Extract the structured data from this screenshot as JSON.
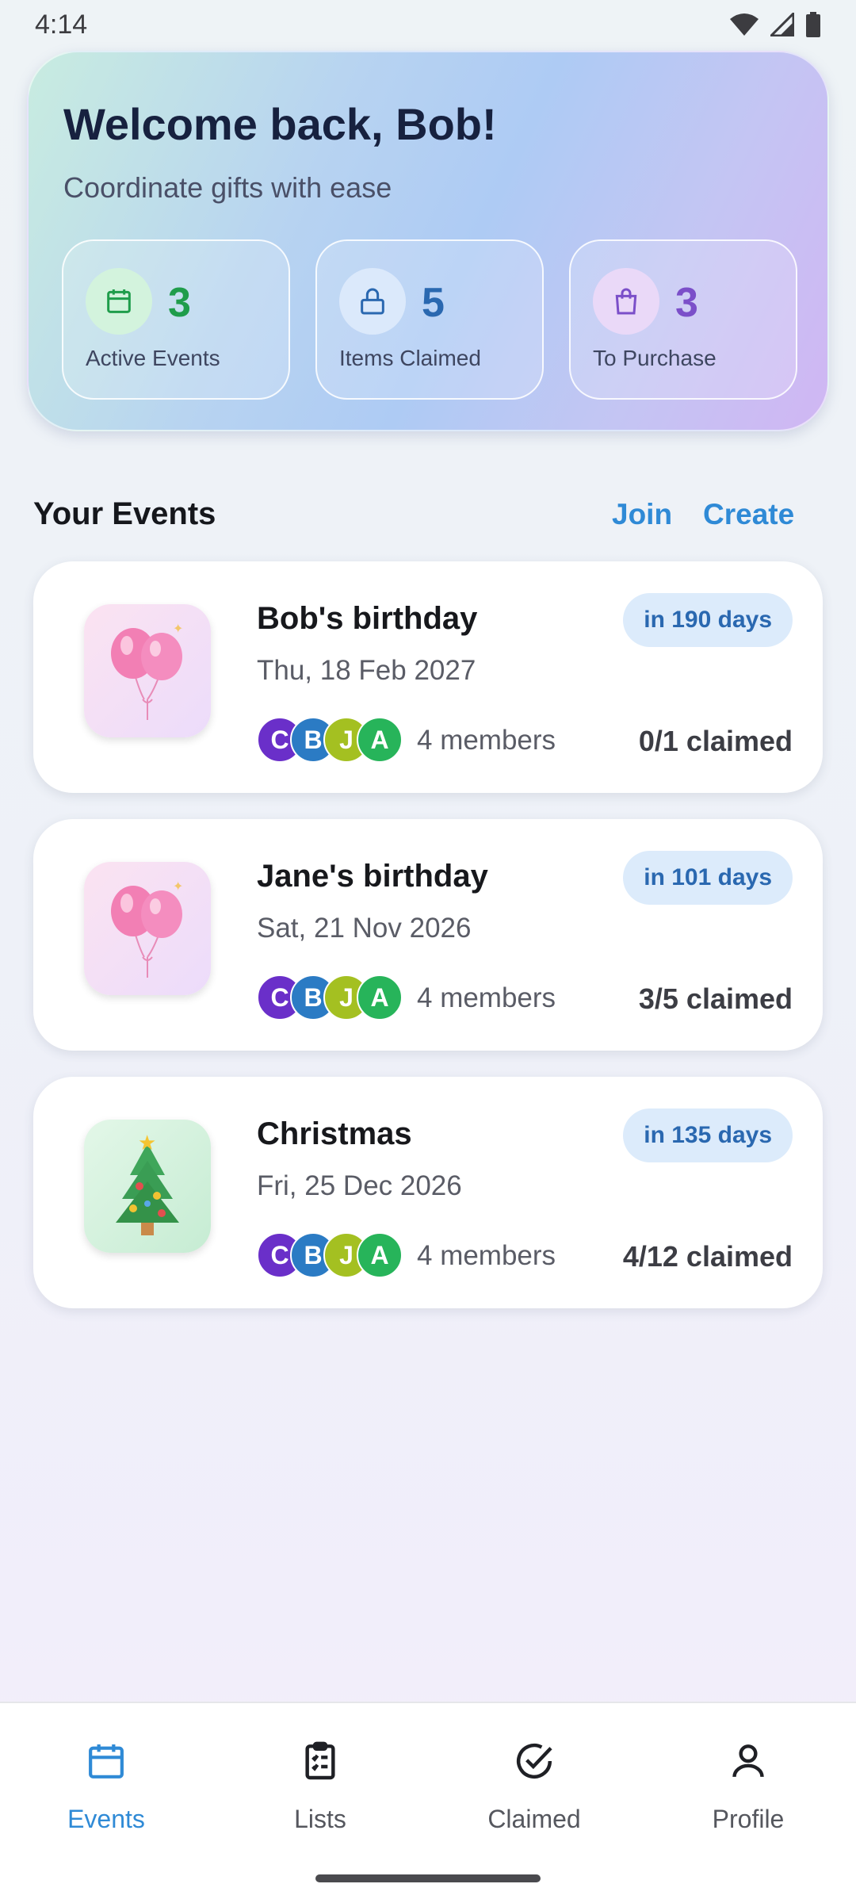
{
  "status_bar": {
    "time": "4:14"
  },
  "hero": {
    "title": "Welcome back, Bob!",
    "subtitle": "Coordinate gifts with ease",
    "stats": [
      {
        "value": "3",
        "label": "Active Events",
        "icon": "calendar-icon",
        "color": "#1f9d4b"
      },
      {
        "value": "5",
        "label": "Items Claimed",
        "icon": "lock-icon",
        "color": "#2a68b0"
      },
      {
        "value": "3",
        "label": "To Purchase",
        "icon": "shopping-bag-icon",
        "color": "#7b4fc9"
      }
    ]
  },
  "events_section": {
    "title": "Your Events",
    "join_label": "Join",
    "create_label": "Create"
  },
  "events": [
    {
      "title": "Bob's birthday",
      "date": "Thu, 18 Feb 2027",
      "countdown": "in 190 days",
      "members": "4 members",
      "claimed": "0/1 claimed",
      "icon": "balloons-icon",
      "avatars": [
        "C",
        "B",
        "J",
        "A"
      ]
    },
    {
      "title": "Jane's birthday",
      "date": "Sat, 21 Nov 2026",
      "countdown": "in 101 days",
      "members": "4 members",
      "claimed": "3/5 claimed",
      "icon": "balloons-icon",
      "avatars": [
        "C",
        "B",
        "J",
        "A"
      ]
    },
    {
      "title": "Christmas",
      "date": "Fri, 25 Dec 2026",
      "countdown": "in 135 days",
      "members": "4 members",
      "claimed": "4/12 claimed",
      "icon": "christmas-tree-icon",
      "avatars": [
        "C",
        "B",
        "J",
        "A"
      ]
    }
  ],
  "avatar_colors": [
    "#6a2fc9",
    "#2b7bc4",
    "#a4c021",
    "#27b45a"
  ],
  "nav": [
    {
      "label": "Events",
      "icon": "calendar-icon",
      "active": true
    },
    {
      "label": "Lists",
      "icon": "checklist-icon",
      "active": false
    },
    {
      "label": "Claimed",
      "icon": "check-circle-icon",
      "active": false
    },
    {
      "label": "Profile",
      "icon": "person-icon",
      "active": false
    }
  ],
  "colors": {
    "accent": "#2f8ad6",
    "badge_bg": "#dcebfb",
    "badge_text": "#2a68b0"
  }
}
